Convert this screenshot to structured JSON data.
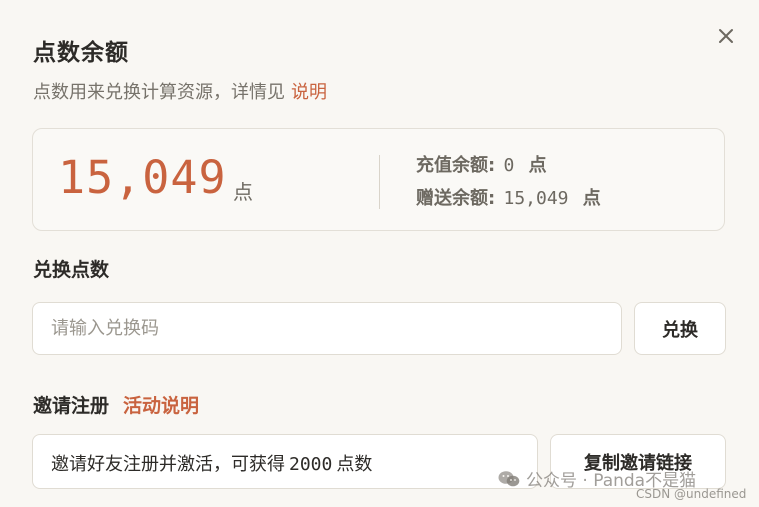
{
  "dialog": {
    "title": "点数余额",
    "subtitle": "点数用来兑换计算资源，详情见",
    "subtitle_link": "说明",
    "close_icon": "close-icon"
  },
  "balance": {
    "total": "15,049",
    "total_unit": "点",
    "recharge_label": "充值余额:",
    "recharge_value": "0",
    "recharge_unit": "点",
    "gift_label": "赠送余额:",
    "gift_value": "15,049",
    "gift_unit": "点"
  },
  "redeem": {
    "section_title": "兑换点数",
    "input_placeholder": "请输入兑换码",
    "input_value": "",
    "button_label": "兑换"
  },
  "invite": {
    "section_title": "邀请注册",
    "section_link": "活动说明",
    "text_before": "邀请好友注册并激活，可获得",
    "points": "2000",
    "text_after": "点数",
    "copy_button_label": "复制邀请链接"
  },
  "watermark": {
    "wechat_text": "公众号 · Panda不是猫",
    "csdn_text": "CSDN @undefined",
    "icon": "wechat-icon"
  },
  "colors": {
    "accent": "#c9633f",
    "text": "#2d2b28",
    "muted": "#77736b",
    "background": "#f9f7f3",
    "border": "#e0dcd3"
  }
}
